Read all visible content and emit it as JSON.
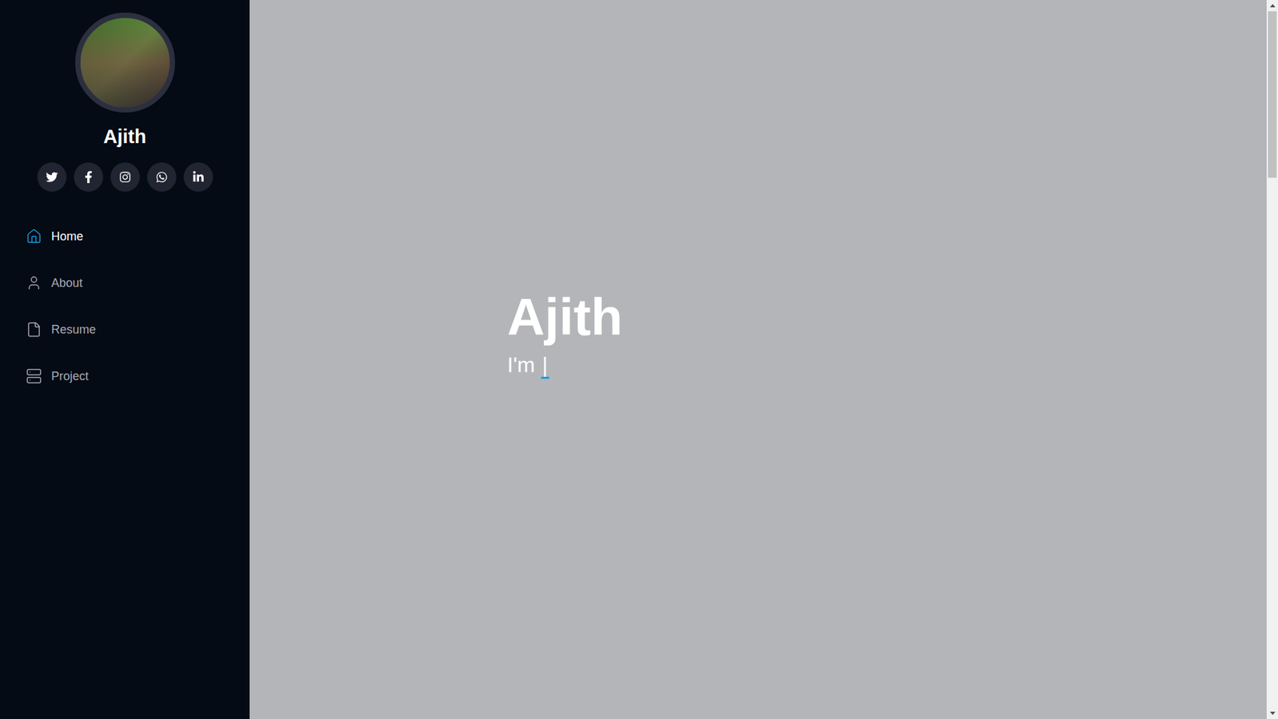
{
  "sidebar": {
    "name": "Ajith",
    "social": [
      {
        "kind": "twitter"
      },
      {
        "kind": "facebook"
      },
      {
        "kind": "instagram"
      },
      {
        "kind": "whatsapp"
      },
      {
        "kind": "linkedin"
      }
    ],
    "items": [
      {
        "label": "Home",
        "kind": "home",
        "selected": true
      },
      {
        "label": "About",
        "kind": "about",
        "selected": false
      },
      {
        "label": "Resume",
        "kind": "resume",
        "selected": false
      },
      {
        "label": "Project",
        "kind": "project",
        "selected": false
      }
    ]
  },
  "hero": {
    "title": "Ajith",
    "subtitle": "I'm ",
    "cursor": "|"
  }
}
